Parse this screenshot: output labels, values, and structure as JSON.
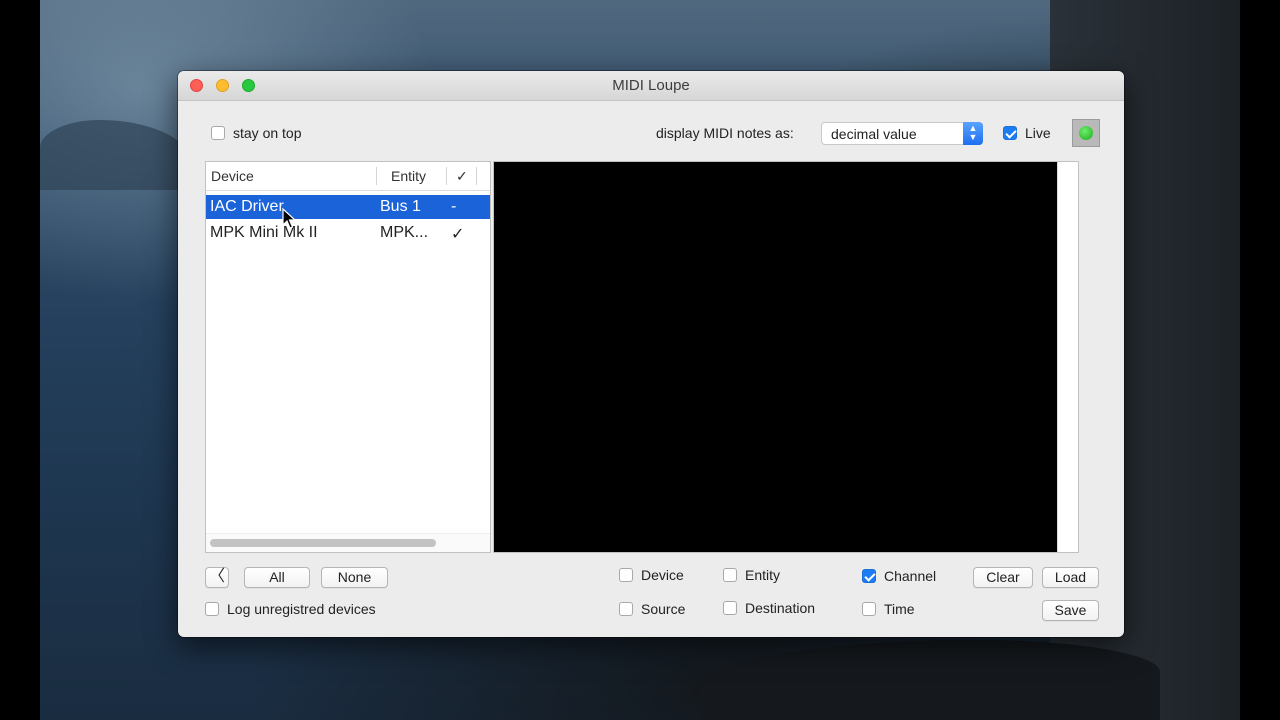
{
  "window": {
    "title": "MIDI Loupe"
  },
  "toolbar": {
    "stay_on_top_label": "stay on top",
    "stay_on_top_checked": false,
    "display_notes_label": "display MIDI notes as:",
    "display_notes_value": "decimal value",
    "live_label": "Live",
    "live_checked": true,
    "activity_led_color": "#2fc42f"
  },
  "device_table": {
    "headers": {
      "device": "Device",
      "entity": "Entity",
      "check": "✓"
    },
    "rows": [
      {
        "device": "IAC Driver",
        "entity": "Bus 1",
        "check": "-",
        "selected": true
      },
      {
        "device": "MPK Mini Mk II",
        "entity": "MPK...",
        "check": "✓",
        "selected": false
      }
    ]
  },
  "bottom": {
    "back_icon": "chevron-left-icon",
    "back_glyph": "〈",
    "all_label": "All",
    "none_label": "None",
    "log_unregistered_label": "Log unregistred devices",
    "log_unregistered_checked": false,
    "filters": {
      "device": {
        "label": "Device",
        "checked": false
      },
      "entity": {
        "label": "Entity",
        "checked": false
      },
      "channel": {
        "label": "Channel",
        "checked": true
      },
      "source": {
        "label": "Source",
        "checked": false
      },
      "destination": {
        "label": "Destination",
        "checked": false
      },
      "time": {
        "label": "Time",
        "checked": false
      }
    },
    "clear_label": "Clear",
    "load_label": "Load",
    "save_label": "Save"
  },
  "colors": {
    "selection": "#1a63d9",
    "checkbox_checked": "#1c7cf4",
    "console_background": "#000000"
  }
}
